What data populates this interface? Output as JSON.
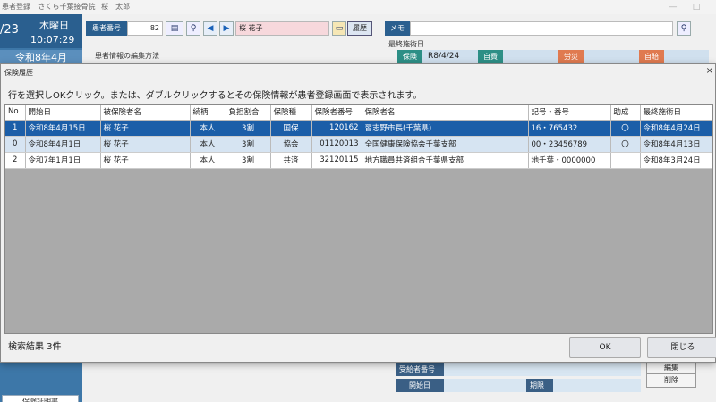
{
  "titlebar": {
    "app_name": "患者登録",
    "clinic": "さくら千葉接骨院",
    "user": "桜　太郎",
    "minimize": "—",
    "maximize": "□"
  },
  "left": {
    "date": "/23",
    "weekday": "木曜日",
    "time": "10:07:29",
    "era_month": "令和8年4月",
    "bottom_button": "保険証明書"
  },
  "header": {
    "patient_no_label": "患者番号",
    "patient_no": "82",
    "patient_name": "桜 花子",
    "history_button": "履歴",
    "memo_label": "メモ",
    "memo_value": ""
  },
  "background": {
    "edit_method": "患者情報の編集方法",
    "last_visit_label": "最終施術日",
    "tag_hoken": "保険",
    "last_visit_value": "R8/4/24",
    "tag_jihi": "自費",
    "tag_rousai": "労災",
    "tag_jiko": "自賠",
    "recipient_no_label": "受給者番号",
    "start_date_label": "開始日",
    "period_label": "期限",
    "edit_button": "編集",
    "delete_button": "削除"
  },
  "dialog": {
    "title": "保険履歴",
    "close": "×",
    "instruction": "行を選択しOKクリック。または、ダブルクリックするとその保険情報が患者登録画面で表示されます。",
    "columns": [
      "No",
      "開始日",
      "被保険者名",
      "続柄",
      "負担割合",
      "保険種",
      "保険者番号",
      "保険者名",
      "記号・番号",
      "助成",
      "最終施術日"
    ],
    "rows": [
      [
        "1",
        "令和8年4月15日",
        "桜 花子",
        "本人",
        "3割",
        "国保",
        "120162",
        "習志野市長(千葉県)",
        "16・765432",
        "〇",
        "令和8年4月24日"
      ],
      [
        "0",
        "令和8年4月1日",
        "桜 花子",
        "本人",
        "3割",
        "協会",
        "01120013",
        "全国健康保険協会千葉支部",
        "00・23456789",
        "〇",
        "令和8年4月13日"
      ],
      [
        "2",
        "令和7年1月1日",
        "桜 花子",
        "本人",
        "3割",
        "共済",
        "32120115",
        "地方職員共済組合千葉県支部",
        "地千葉・0000000",
        "",
        "令和8年3月24日"
      ]
    ],
    "status": "検索結果 3件",
    "ok_button": "OK",
    "close_button": "閉じる"
  }
}
